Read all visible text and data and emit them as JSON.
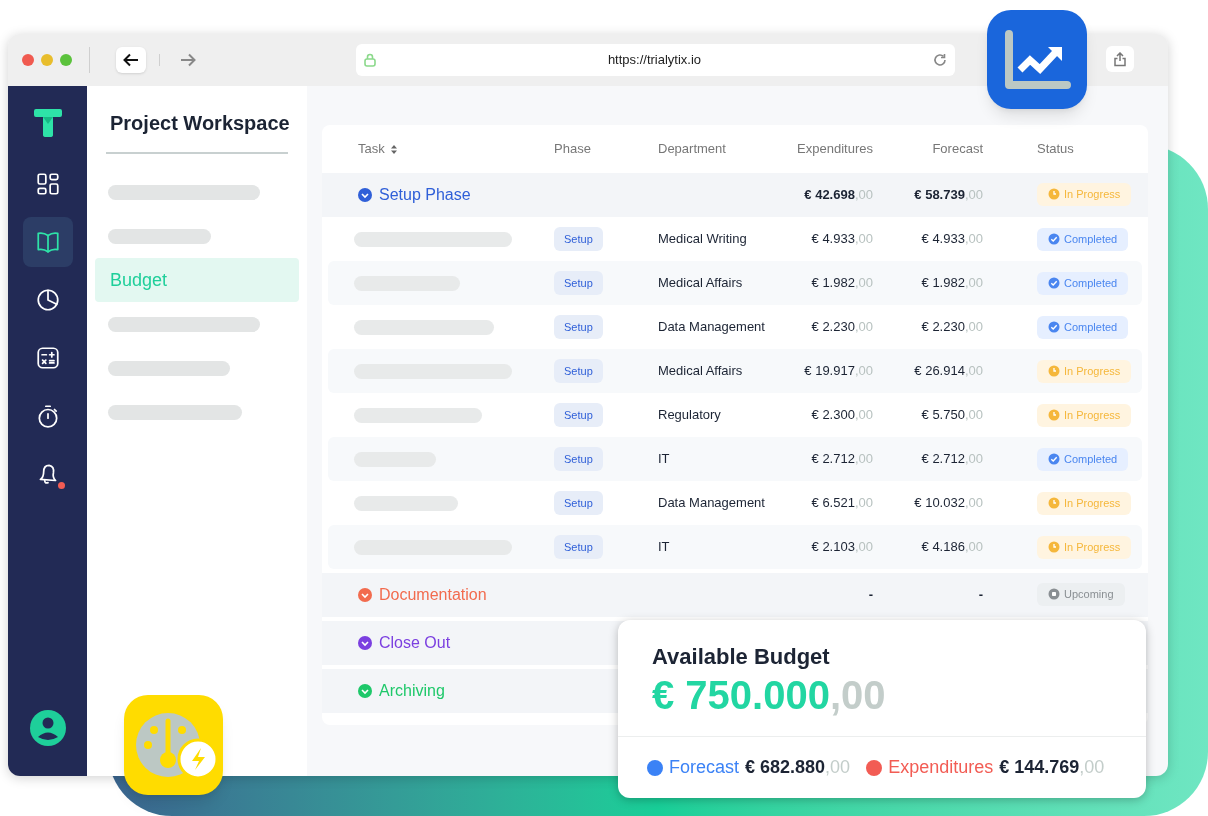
{
  "browser": {
    "url": "https://trialytix.io"
  },
  "nav": [
    {
      "kind": "dashboard",
      "selected": false,
      "notification": false
    },
    {
      "kind": "book",
      "selected": true,
      "notification": false
    },
    {
      "kind": "pie",
      "selected": false,
      "notification": false
    },
    {
      "kind": "calculator",
      "selected": false,
      "notification": false
    },
    {
      "kind": "stopwatch",
      "selected": false,
      "notification": false
    },
    {
      "kind": "bell",
      "selected": false,
      "notification": true
    }
  ],
  "workspace": {
    "title": "Project Workspace",
    "items": [
      {
        "kind": "placeholder",
        "selected": false
      },
      {
        "kind": "placeholder",
        "selected": false
      },
      {
        "kind": "link",
        "label": "Budget",
        "selected": true
      },
      {
        "kind": "placeholder",
        "selected": false
      },
      {
        "kind": "placeholder",
        "selected": false
      },
      {
        "kind": "placeholder",
        "selected": false
      }
    ]
  },
  "table": {
    "columns": [
      {
        "label": "Task",
        "sortable": true
      },
      {
        "label": "Phase",
        "sortable": false
      },
      {
        "label": "Department",
        "sortable": false
      },
      {
        "label": "Expenditures",
        "sortable": false
      },
      {
        "label": "Forecast",
        "sortable": false
      },
      {
        "label": "Status",
        "sortable": false
      }
    ],
    "groups": [
      {
        "name": "Setup Phase",
        "color": "#2f5fd8",
        "expenditures": "€ 42.698,00",
        "forecast": "€ 58.739,00",
        "status": {
          "kind": "in_progress",
          "label": "In Progress"
        },
        "rows": [
          {
            "phase": "Setup",
            "department": "Medical Writing",
            "expenditures": "€ 4.933,00",
            "forecast": "€ 4.933,00",
            "status": {
              "kind": "completed",
              "label": "Completed"
            }
          },
          {
            "phase": "Setup",
            "department": "Medical Affairs",
            "expenditures": "€ 1.982,00",
            "forecast": "€ 1.982,00",
            "status": {
              "kind": "completed",
              "label": "Completed"
            }
          },
          {
            "phase": "Setup",
            "department": "Data Management",
            "expenditures": "€ 2.230,00",
            "forecast": "€ 2.230,00",
            "status": {
              "kind": "completed",
              "label": "Completed"
            }
          },
          {
            "phase": "Setup",
            "department": "Medical Affairs",
            "expenditures": "€ 19.917,00",
            "forecast": "€ 26.914,00",
            "status": {
              "kind": "in_progress",
              "label": "In Progress"
            }
          },
          {
            "phase": "Setup",
            "department": "Regulatory",
            "expenditures": "€ 2.300,00",
            "forecast": "€ 5.750,00",
            "status": {
              "kind": "in_progress",
              "label": "In Progress"
            }
          },
          {
            "phase": "Setup",
            "department": "IT",
            "expenditures": "€ 2.712,00",
            "forecast": "€ 2.712,00",
            "status": {
              "kind": "completed",
              "label": "Completed"
            }
          },
          {
            "phase": "Setup",
            "department": "Data Management",
            "expenditures": "€ 6.521,00",
            "forecast": "€ 10.032,00",
            "status": {
              "kind": "in_progress",
              "label": "In Progress"
            }
          },
          {
            "phase": "Setup",
            "department": "IT",
            "expenditures": "€ 2.103,00",
            "forecast": "€ 4.186,00",
            "status": {
              "kind": "in_progress",
              "label": "In Progress"
            }
          }
        ]
      },
      {
        "name": "Documentation",
        "color": "#f26b4e",
        "expenditures": "-",
        "forecast": "-",
        "status": {
          "kind": "upcoming",
          "label": "Upcoming"
        }
      },
      {
        "name": "Close Out",
        "color": "#7b3fe0"
      },
      {
        "name": "Archiving",
        "color": "#1ec86a"
      }
    ]
  },
  "budget": {
    "title": "Available Budget",
    "amount": "€ 750.000,00",
    "legend": [
      {
        "label": "Forecast",
        "color": "#3b82f6",
        "amount": "€ 682.880,00"
      },
      {
        "label": "Expenditures",
        "color": "#f25c54",
        "amount": "€ 144.769,00"
      }
    ]
  }
}
